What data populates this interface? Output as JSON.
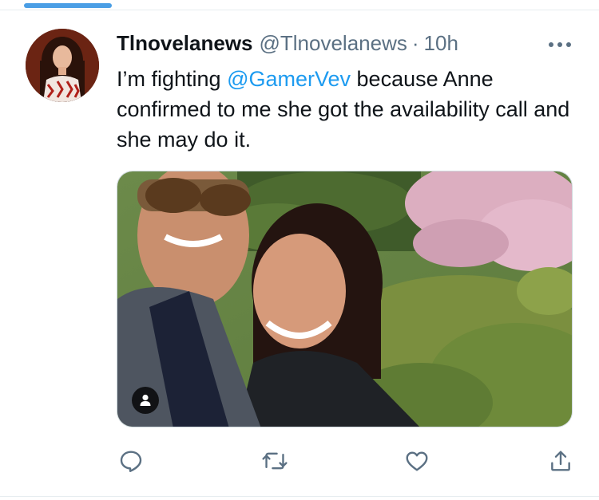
{
  "tweet": {
    "display_name": "Tlnovelanews",
    "handle": "@Tlnovelanews",
    "separator": "·",
    "time": "10h",
    "text_before": "I’m fighting ",
    "mention": "@GamerVev",
    "text_after": " because Anne confirmed to me she got the availability call and she may do it."
  },
  "icons": {
    "more": "more-horizontal-icon",
    "reply": "reply-icon",
    "retweet": "retweet-icon",
    "like": "heart-icon",
    "share": "share-icon",
    "tagged": "person-icon"
  },
  "colors": {
    "accent": "#1d9bf0",
    "secondary_text": "#5b7083",
    "primary_text": "#0f1419",
    "tab_indicator": "#4a9ee5"
  }
}
